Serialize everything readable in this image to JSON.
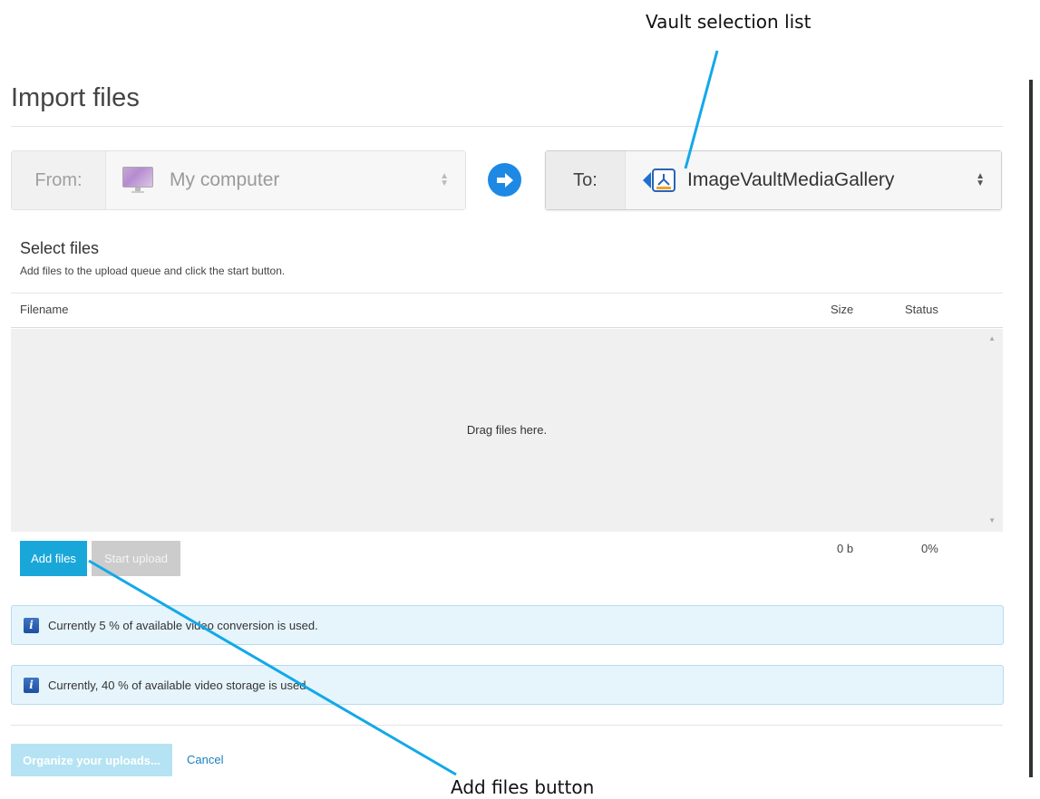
{
  "annotations": {
    "vault_selection_list": "Vault selection list",
    "add_files_button": "Add files button"
  },
  "page": {
    "title": "Import files"
  },
  "from": {
    "label": "From:",
    "value": "My computer",
    "icon": "monitor-icon"
  },
  "to": {
    "label": "To:",
    "value": "ImageVaultMediaGallery",
    "icon": "imagevault-icon"
  },
  "select_files": {
    "heading": "Select files",
    "subtitle": "Add files to the upload queue and click the start button."
  },
  "table": {
    "columns": [
      "Filename",
      "Size",
      "Status"
    ],
    "drop_text": "Drag files here.",
    "total_size": "0 b",
    "total_status": "0%"
  },
  "buttons": {
    "add_files": "Add files",
    "start_upload": "Start upload",
    "organize": "Organize your uploads...",
    "cancel": "Cancel"
  },
  "info": {
    "conversion": "Currently 5 % of available video conversion is used.",
    "storage": "Currently, 40 % of available video storage is used."
  },
  "colors": {
    "accent": "#19a7d9",
    "arrow": "#1e88e5",
    "callout_line": "#12a9e8",
    "info_bg": "#e6f4fb"
  }
}
